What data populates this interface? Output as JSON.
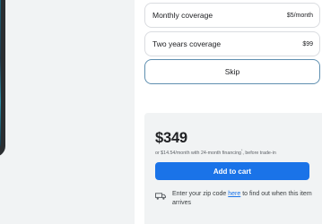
{
  "protection_options": [
    {
      "label": "Monthly coverage",
      "price": "$5/month"
    },
    {
      "label": "Two years coverage",
      "price": "$99"
    }
  ],
  "skip_label": "Skip",
  "purchase": {
    "price": "$349",
    "financing_text_before": "or $14.54/month with 24-month financing",
    "financing_marker": "*",
    "financing_text_after": ", before trade-in",
    "add_to_cart_label": "Add to cart",
    "delivery_prefix": "Enter your zip code ",
    "delivery_link": "here",
    "delivery_suffix": " to find out when this item arrives"
  },
  "colors": {
    "accent": "#1a73e8",
    "panel_background": "#f1f3f4",
    "skip_border": "#5f8fb0"
  },
  "icons": {
    "delivery": "truck-icon"
  }
}
